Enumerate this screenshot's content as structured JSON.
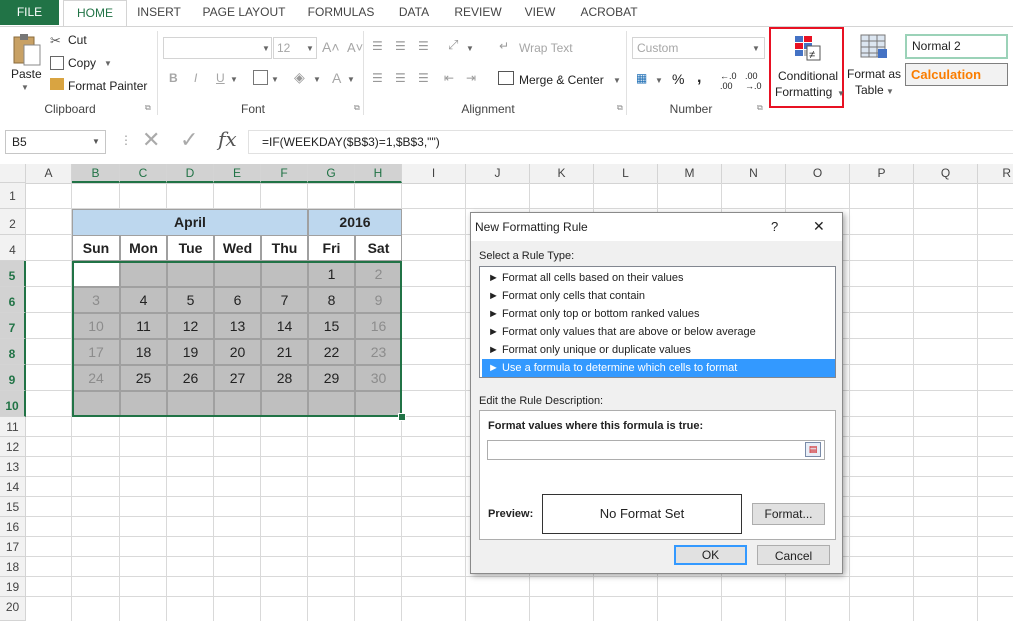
{
  "ribbon": {
    "tabs": [
      "FILE",
      "HOME",
      "INSERT",
      "PAGE LAYOUT",
      "FORMULAS",
      "DATA",
      "REVIEW",
      "VIEW",
      "ACROBAT"
    ],
    "clipboard": {
      "paste": "Paste",
      "cut": "Cut",
      "copy": "Copy",
      "format_painter": "Format Painter",
      "label": "Clipboard"
    },
    "font": {
      "size": "12",
      "label": "Font",
      "bold": "B",
      "italic": "I",
      "underline": "U"
    },
    "alignment": {
      "wrap_text": "Wrap Text",
      "merge_center": "Merge & Center",
      "label": "Alignment"
    },
    "number": {
      "format": "Custom",
      "percent": "%",
      "comma": ",",
      "label": "Number",
      "inc_dec": "←.0 .00",
      "dec_dec": ".00 →.0"
    },
    "styles": {
      "conditional_formatting_line1": "Conditional",
      "conditional_formatting_line2": "Formatting",
      "format_as_table_line1": "Format as",
      "format_as_table_line2": "Table",
      "style_normal2": "Normal 2",
      "style_calculation": "Calculation"
    }
  },
  "formula_bar": {
    "name_box": "B5",
    "fx": "fx",
    "formula": "=IF(WEEKDAY($B$3)=1,$B$3,\"\")"
  },
  "columns": [
    "A",
    "B",
    "C",
    "D",
    "E",
    "F",
    "G",
    "H",
    "I",
    "J",
    "K",
    "L",
    "M",
    "N",
    "O",
    "P",
    "Q",
    "R"
  ],
  "rows": [
    "1",
    "2",
    "4",
    "5",
    "6",
    "7",
    "8",
    "9",
    "10",
    "11",
    "12",
    "13",
    "14",
    "15",
    "16",
    "17",
    "18",
    "19",
    "20"
  ],
  "calendar": {
    "month": "April",
    "year": "2016",
    "weekdays": [
      "Sun",
      "Mon",
      "Tue",
      "Wed",
      "Thu",
      "Fri",
      "Sat"
    ],
    "weeks": [
      [
        "",
        "",
        "",
        "",
        "",
        "1",
        "2"
      ],
      [
        "3",
        "4",
        "5",
        "6",
        "7",
        "8",
        "9"
      ],
      [
        "10",
        "11",
        "12",
        "13",
        "14",
        "15",
        "16"
      ],
      [
        "17",
        "18",
        "19",
        "20",
        "21",
        "22",
        "23"
      ],
      [
        "24",
        "25",
        "26",
        "27",
        "28",
        "29",
        "30"
      ],
      [
        "",
        "",
        "",
        "",
        "",
        "",
        ""
      ]
    ]
  },
  "dialog": {
    "title": "New Formatting Rule",
    "help": "?",
    "close": "✕",
    "select_rule_type": "Select a Rule Type:",
    "rule_types": [
      "Format all cells based on their values",
      "Format only cells that contain",
      "Format only top or bottom ranked values",
      "Format only values that are above or below average",
      "Format only unique or duplicate values",
      "Use a formula to determine which cells to format"
    ],
    "edit_description": "Edit the Rule Description:",
    "formula_label": "Format values where this formula is true:",
    "formula_value": "",
    "preview_label": "Preview:",
    "preview_text": "No Format Set",
    "format_button": "Format...",
    "ok": "OK",
    "cancel": "Cancel"
  },
  "colors": {
    "excel_green": "#217346",
    "highlight_red": "#e81123",
    "calendar_header": "#bdd7ee",
    "calendar_cell": "#bfbfbf",
    "selection_blue": "#3399ff"
  }
}
